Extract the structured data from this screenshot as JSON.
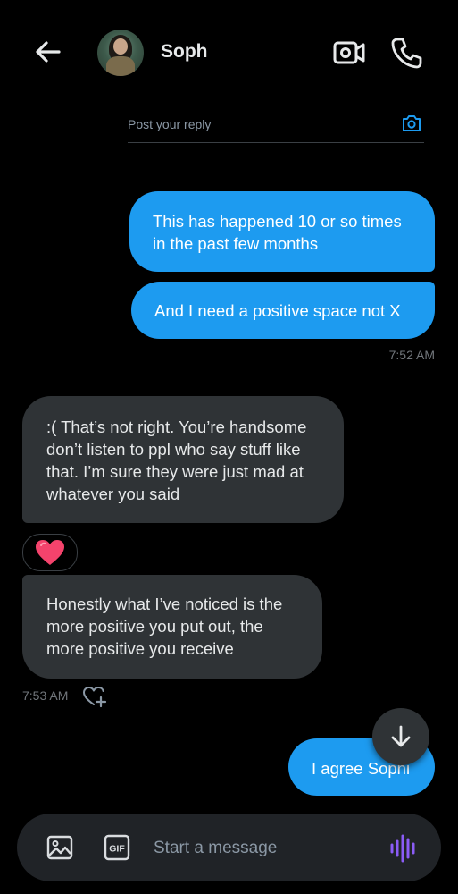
{
  "header": {
    "contact_name": "Soph",
    "back_icon": "arrow-left-icon",
    "video_icon": "video-camera-icon",
    "call_icon": "phone-icon"
  },
  "reply": {
    "placeholder": "Post your reply",
    "camera_icon": "camera-icon"
  },
  "messages": [
    {
      "direction": "out",
      "text": "This has happened 10 or so times in the past few months"
    },
    {
      "direction": "out",
      "text": "And I need a positive space not X",
      "time": "7:52 AM"
    },
    {
      "direction": "in",
      "text": ":( That’s not right. You’re handsome don’t listen to ppl who say stuff like that. I’m sure they were just mad at whatever you said",
      "reaction": "heart"
    },
    {
      "direction": "in",
      "text": "Honestly what I’ve noticed is the more positive you put out, the more positive you receive",
      "time": "7:53 AM"
    },
    {
      "direction": "out",
      "text": "I agree Sophi"
    }
  ],
  "composer": {
    "placeholder": "Start a message",
    "gif_label": "GIF",
    "image_icon": "image-icon",
    "voice_icon": "voice-waveform-icon"
  },
  "colors": {
    "background": "#000000",
    "outgoing_bubble": "#1d9bf0",
    "incoming_bubble": "#2f3336",
    "heart": "#f4436c",
    "voice_accent": "#8b5cf6",
    "camera_accent": "#1d9bf0"
  }
}
